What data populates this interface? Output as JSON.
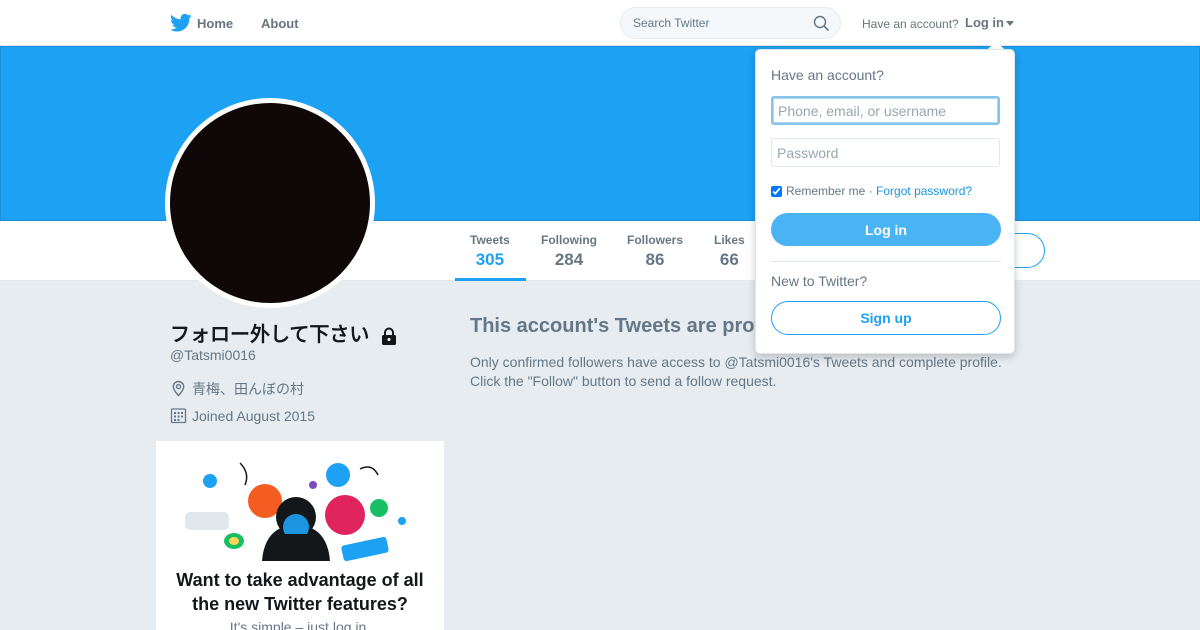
{
  "nav": {
    "home_label": "Home",
    "about_label": "About",
    "search_placeholder": "Search Twitter",
    "have_account": "Have an account?",
    "login_label": "Log in",
    "icons": {
      "brand": "twitter-bird-icon",
      "search": "search-icon",
      "caret": "caret-down-icon"
    }
  },
  "colors": {
    "brand": "#1da1f2",
    "banner": "#1da1f2",
    "button": "#4ab3f4",
    "avatar": "#100808"
  },
  "stats": {
    "tweets_label": "Tweets",
    "tweets_value": "305",
    "following_label": "Following",
    "following_value": "284",
    "followers_label": "Followers",
    "followers_value": "86",
    "likes_label": "Likes",
    "likes_value": "66"
  },
  "profile": {
    "name": "フォロー外して下さい",
    "handle": "@Tatsmi0016",
    "location": "青梅、田んぼの村",
    "joined": "Joined August 2015"
  },
  "protected": {
    "title": "This account's Tweets are protected.",
    "body": "Only confirmed followers have access to @Tatsmi0016's Tweets and complete profile. Click the \"Follow\" button to send a follow request."
  },
  "promo": {
    "title": "Want to take advantage of all the new Twitter features?",
    "subtitle": "It's simple – just log in."
  },
  "login_dropdown": {
    "heading": "Have an account?",
    "username_placeholder": "Phone, email, or username",
    "password_placeholder": "Password",
    "remember_label": "Remember me",
    "separator": "·",
    "forgot_label": "Forgot password?",
    "remember_checked": true,
    "login_button": "Log in",
    "new_to_twitter": "New to Twitter?",
    "signup_button": "Sign up"
  }
}
